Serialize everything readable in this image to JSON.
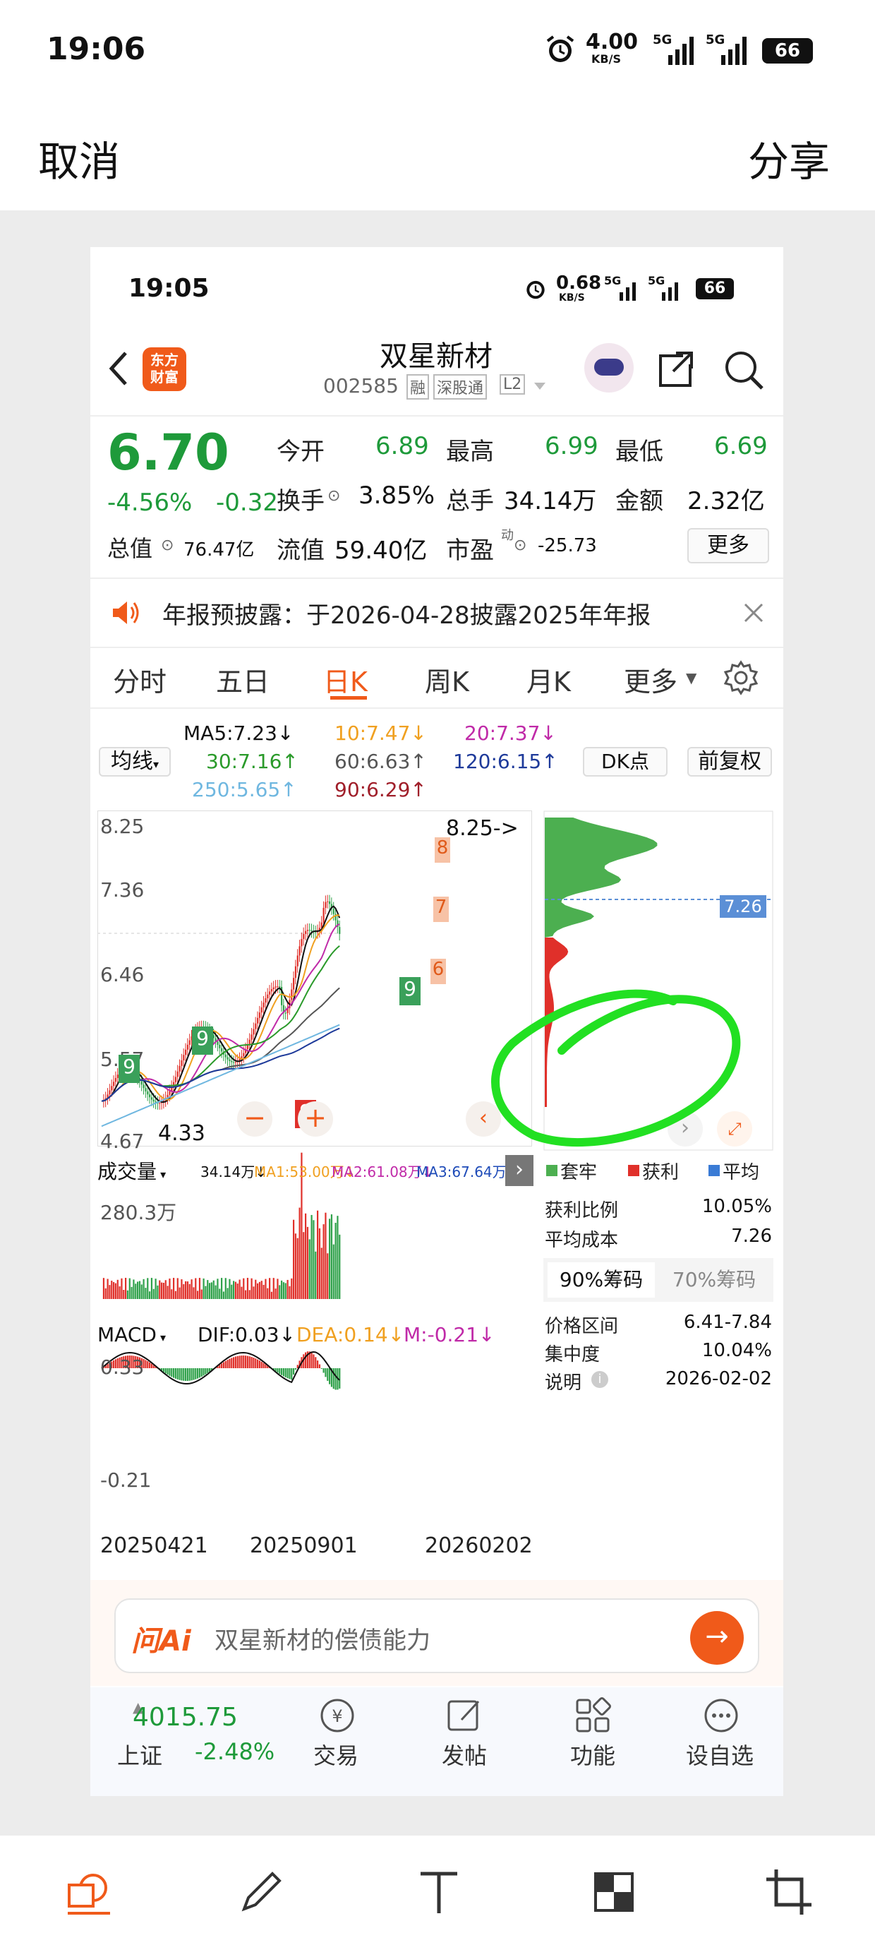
{
  "outer": {
    "status": {
      "time": "19:06",
      "net_speed": "4.00",
      "net_unit": "KB/S",
      "signal1": "5G",
      "signal2": "5G",
      "battery": "66"
    },
    "header": {
      "cancel": "取消",
      "share": "分享"
    }
  },
  "inner_status": {
    "time": "19:05",
    "net_speed": "0.68",
    "net_unit": "KB/S",
    "signal1": "5G",
    "signal2": "5G",
    "battery": "66"
  },
  "stock": {
    "logo_line1": "东方",
    "logo_line2": "财富",
    "name": "双星新材",
    "code": "002585",
    "tag1": "融",
    "tag2": "深股通",
    "tag3": "L2",
    "price": "6.70",
    "change_pct": "-4.56%",
    "change": "-0.32",
    "open_label": "今开",
    "open": "6.89",
    "high_label": "最高",
    "high": "6.99",
    "low_label": "最低",
    "low": "6.69",
    "turnover_label": "换手",
    "turnover": "3.85%",
    "volume_label": "总手",
    "volume": "34.14万",
    "amount_label": "金额",
    "amount": "2.32亿",
    "mcap_label": "总值",
    "mcap": "76.47亿",
    "float_label": "流值",
    "float": "59.40亿",
    "pe_label": "市盈",
    "pe_sup": "动",
    "pe": "-25.73",
    "more": "更多"
  },
  "notice": {
    "text": "年报预披露：于2026-04-28披露2025年年报"
  },
  "tabs": [
    "分时",
    "五日",
    "日K",
    "周K",
    "月K",
    "更多"
  ],
  "ma": {
    "selector": "均线",
    "ma5": "MA5:7.23↓",
    "ma10": "10:7.47↓",
    "ma20": "20:7.37↓",
    "ma30": "30:7.16↑",
    "ma60": "60:6.63↑",
    "ma120": "120:6.15↑",
    "ma250": "250:5.65↑",
    "ma90": "90:6.29↑",
    "dk": "DK点",
    "adjust": "前复权"
  },
  "kchart": {
    "y_labels": [
      "8.25",
      "7.36",
      "6.46",
      "5.57",
      "4.67"
    ],
    "high_marker": "8.25->",
    "low_marker": "4.33",
    "cost_line": "7.26",
    "td_markers": [
      "8",
      "7",
      "6",
      "9",
      "9",
      "9",
      "9"
    ],
    "colors": {
      "up": "#e0302a",
      "down": "#2fa14a",
      "ma5": "#111111",
      "ma10": "#f0a020",
      "ma20": "#c02aa8",
      "ma30": "#2a9a2a",
      "ma60": "#555555",
      "ma120": "#1e3a9a",
      "ma250": "#6fb7e0"
    }
  },
  "volume": {
    "selector": "成交量",
    "vol": "34.14万↓",
    "ma1": "MA1:53.00万↓",
    "ma2": "MA2:61.08万↓",
    "ma3": "MA3:67.64万↓",
    "max": "280.3万"
  },
  "macd": {
    "selector": "MACD",
    "dif": "DIF:0.03↓",
    "dea": "DEA:0.14↓",
    "m": "M:-0.21↓",
    "top": "0.33",
    "bottom": "-0.21",
    "dates": [
      "20250421",
      "20250901",
      "20260202"
    ]
  },
  "chips": {
    "legend_trapped": "套牢",
    "legend_profit": "获利",
    "legend_avg": "平均",
    "profit_ratio_label": "获利比例",
    "profit_ratio": "10.05%",
    "avg_cost_label": "平均成本",
    "avg_cost": "7.26",
    "tab90": "90%筹码",
    "tab70": "70%筹码",
    "range_label": "价格区间",
    "range": "6.41-7.84",
    "concentration_label": "集中度",
    "concentration": "10.04%",
    "note_label": "说明",
    "date": "2026-02-02"
  },
  "ai": {
    "logo": "问Ai",
    "placeholder": "双星新材的偿债能力"
  },
  "bottom_nav": {
    "index_value": "4015.75",
    "index_name": "上证",
    "index_change": "-2.48%",
    "trade": "交易",
    "post": "发帖",
    "function": "功能",
    "watch": "设自选"
  }
}
